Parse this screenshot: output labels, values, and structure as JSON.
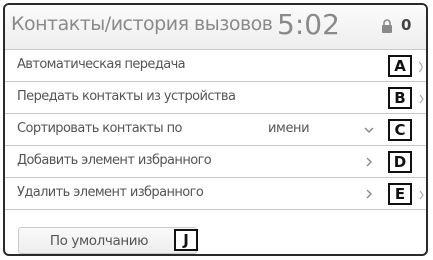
{
  "header": {
    "title": "Контакты/история вызовов",
    "time": "5:02",
    "count": "0"
  },
  "rows": [
    {
      "label": "Автоматическая передача",
      "value": "",
      "tag": "A",
      "arrow": ""
    },
    {
      "label": "Передать контакты из устройства",
      "value": "",
      "tag": "B",
      "arrow": ""
    },
    {
      "label": "Сортировать контакты по",
      "value": "имени",
      "tag": "C",
      "arrow": "chevron-down"
    },
    {
      "label": "Добавить элемент избранного",
      "value": "",
      "tag": "D",
      "arrow": "chevron-right"
    },
    {
      "label": "Удалить элемент избранного",
      "value": "",
      "tag": "E",
      "arrow": "chevron-right"
    }
  ],
  "footer": {
    "default_button": "По умолчанию",
    "tag": "J"
  }
}
